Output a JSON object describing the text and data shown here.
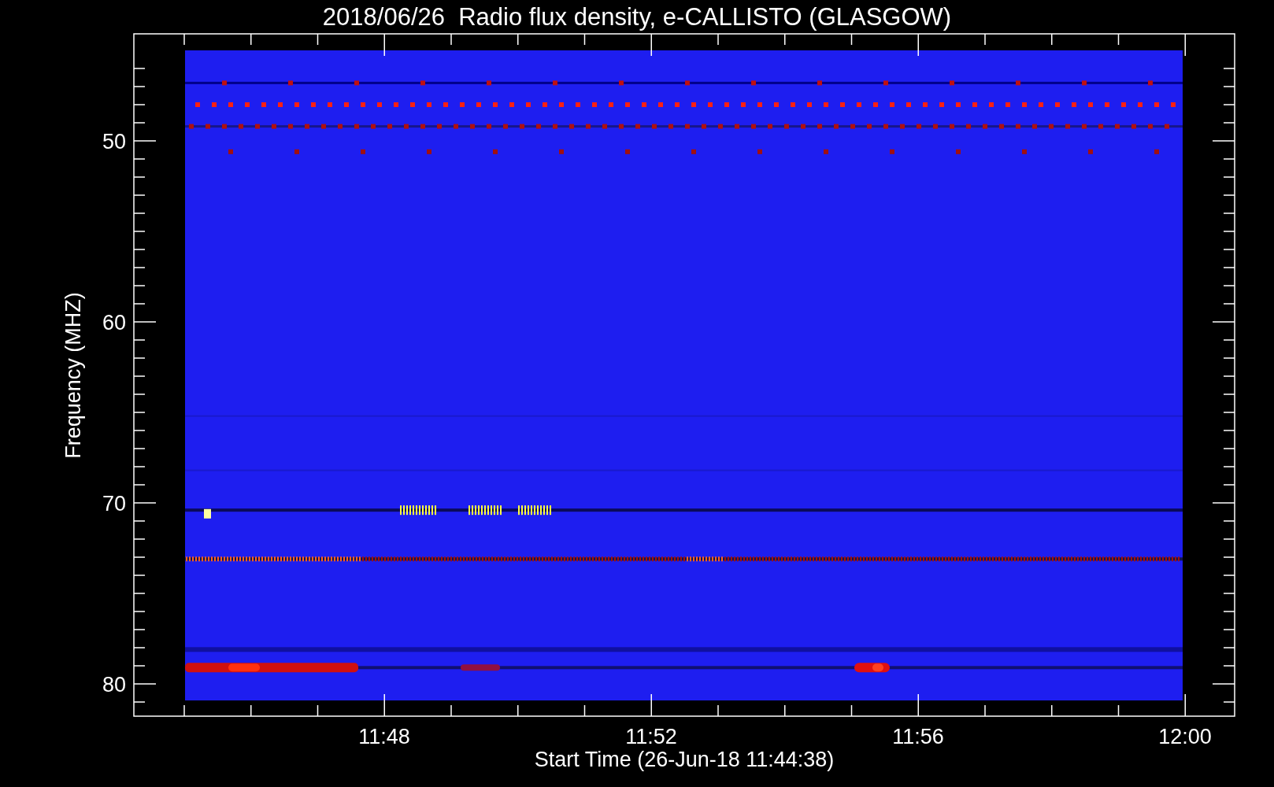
{
  "title": "2018/06/26  Radio flux density, e-CALLISTO (GLASGOW)",
  "y_axis": {
    "label": "Frequency (MHZ)",
    "ticks": [
      "50",
      "60",
      "70",
      "80"
    ]
  },
  "x_axis": {
    "label": "Start Time (26-Jun-18 11:44:38)",
    "ticks": [
      "11:48",
      "11:52",
      "11:56",
      "12:00"
    ]
  }
}
